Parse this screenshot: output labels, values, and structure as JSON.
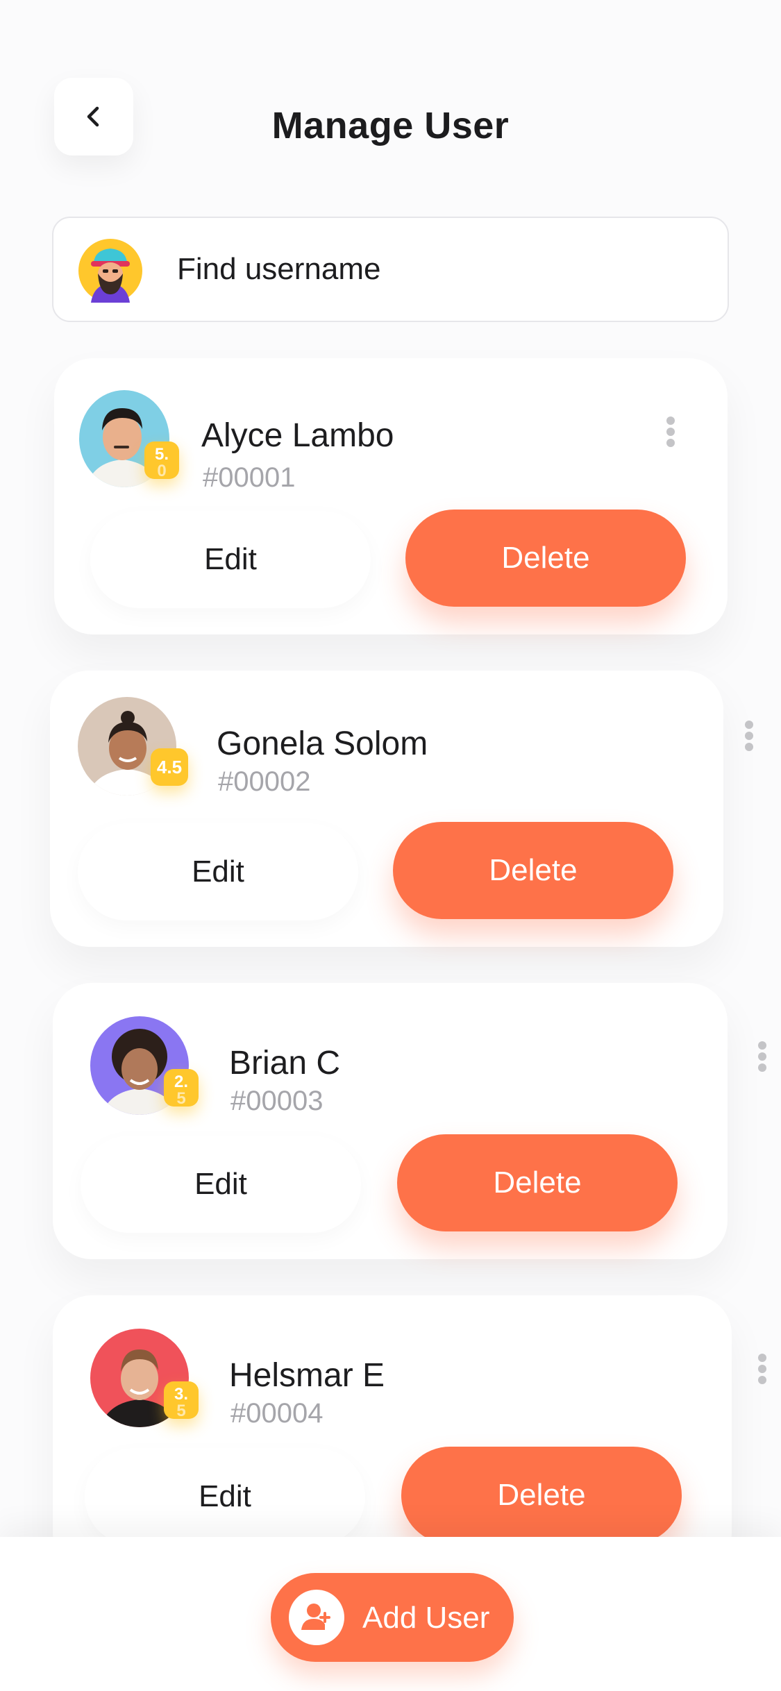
{
  "header": {
    "title": "Manage User"
  },
  "search": {
    "placeholder": "Find username"
  },
  "users": [
    {
      "name": "Alyce Lambo",
      "id": "#00001",
      "rating_top": "5.",
      "rating_bottom": "0",
      "edit_label": "Edit",
      "delete_label": "Delete"
    },
    {
      "name": "Gonela Solom",
      "id": "#00002",
      "rating": "4.5",
      "edit_label": "Edit",
      "delete_label": "Delete"
    },
    {
      "name": "Brian C",
      "id": "#00003",
      "rating_top": "2.",
      "rating_bottom": "5",
      "edit_label": "Edit",
      "delete_label": "Delete"
    },
    {
      "name": "Helsmar E",
      "id": "#00004",
      "rating_top": "3.",
      "rating_bottom": "5",
      "edit_label": "Edit",
      "delete_label": "Delete"
    }
  ],
  "footer": {
    "add_label": "Add User"
  },
  "colors": {
    "accent": "#fe7249",
    "rating": "#ffc72c",
    "muted": "#a5a5aa"
  },
  "icons": {
    "back": "chevron-left-icon",
    "search_avatar": "bearded-man-avatar-icon",
    "kebab": "more-vertical-icon",
    "add_user": "user-plus-icon"
  }
}
